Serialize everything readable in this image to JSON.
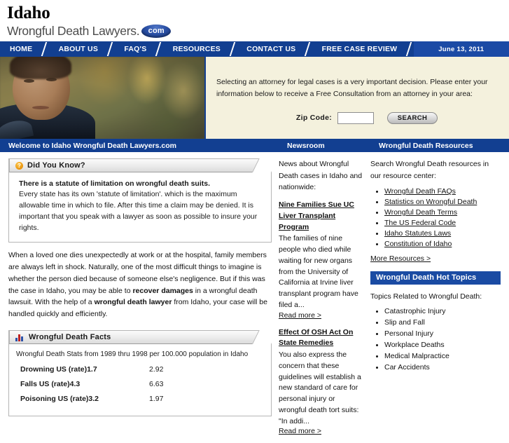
{
  "brand": {
    "state": "Idaho",
    "tagline": "Wrongful Death Lawyers.",
    "badge": "com"
  },
  "nav": {
    "items": [
      {
        "label": "HOME"
      },
      {
        "label": "ABOUT US"
      },
      {
        "label": "FAQ'S"
      },
      {
        "label": "RESOURCES"
      },
      {
        "label": "CONTACT US"
      },
      {
        "label": "FREE CASE REVIEW"
      }
    ],
    "date": "June 13, 2011"
  },
  "hero": {
    "intro": "Selecting an attorney for legal cases is a very important decision. Please enter your information below to receive a Free Consultation from an attorney in your area:",
    "zip_label": "Zip Code:",
    "zip_value": "",
    "zip_placeholder": "",
    "search_label": "SEARCH"
  },
  "sectionbar": {
    "welcome": "Welcome to Idaho Wrongful Death Lawyers.com",
    "newsroom": "Newsroom",
    "resources": "Wrongful Death Resources"
  },
  "did_you_know": {
    "title": "Did You Know?",
    "icon": "question-mark-icon",
    "lead": "There is a statute of limitation on wrongful death suits.",
    "body": "Every state has its own 'statute of limitation'. which is the maximum allowable time in which to file. After this time a claim may be denied. It is important that you speak with a lawyer as soon as possible to insure your rights."
  },
  "main_paragraph": {
    "part1": "When a loved one dies unexpectedly at work or at the hospital, family members are always left in shock. Naturally, one of the most difficult things to imagine is whether the person died because of someone else's negligence. But if this was the case in Idaho, you may be able to ",
    "bold1": "recover damages",
    "part2": " in a wrongful death lawsuit. With the help of a ",
    "bold2": "wrongful death lawyer",
    "part3": " from Idaho, your case will be handled quickly and efficiently."
  },
  "facts": {
    "title": "Wrongful Death Facts",
    "icon": "bar-chart-icon",
    "caption": "Wrongful Death Stats from 1989 thru 1998 per 100.000 population in Idaho",
    "rows": [
      {
        "label": "Drowning US (rate)1.7",
        "value": "2.92"
      },
      {
        "label": "Falls US (rate)4.3",
        "value": "6.63"
      },
      {
        "label": "Poisoning US (rate)3.2",
        "value": "1.97"
      }
    ]
  },
  "news": {
    "intro": "News about Wrongful Death cases in Idaho and nationwide:",
    "items": [
      {
        "title": "Nine Families Sue UC Liver Transplant Program",
        "body": "The families of nine people who died while waiting for new organs from the University of California at Irvine liver transplant program have filed a...",
        "readmore": "Read more >"
      },
      {
        "title": "Effect Of OSH Act On State Remedies",
        "body": "You also express the concern that these guidelines will establish a new standard of care for personal injury or wrongful death tort suits: \"In addi...",
        "readmore": "Read more >"
      }
    ]
  },
  "resources": {
    "intro": "Search Wrongful Death resources in our resource center:",
    "links": [
      {
        "label": "Wrongful Death FAQs"
      },
      {
        "label": "Statistics on Wrongful Death"
      },
      {
        "label": "Wrongful Death Terms"
      },
      {
        "label": "The US Federal Code"
      },
      {
        "label": "Idaho Statutes Laws"
      },
      {
        "label": "Constitution of Idaho"
      }
    ],
    "more": "More Resources >"
  },
  "hot_topics": {
    "heading": "Wrongful Death Hot Topics",
    "intro": "Topics Related to Wrongful Death:",
    "items": [
      {
        "label": "Catastrophic Injury"
      },
      {
        "label": "Slip and Fall"
      },
      {
        "label": "Personal Injury"
      },
      {
        "label": "Workplace Deaths"
      },
      {
        "label": "Medical Malpractice"
      },
      {
        "label": "Car Accidents"
      }
    ]
  },
  "colors": {
    "navy": "#123f91",
    "navy_light": "#1b4aa5",
    "cream": "#f4f1dd",
    "accent_orange": "#e58f0a"
  }
}
